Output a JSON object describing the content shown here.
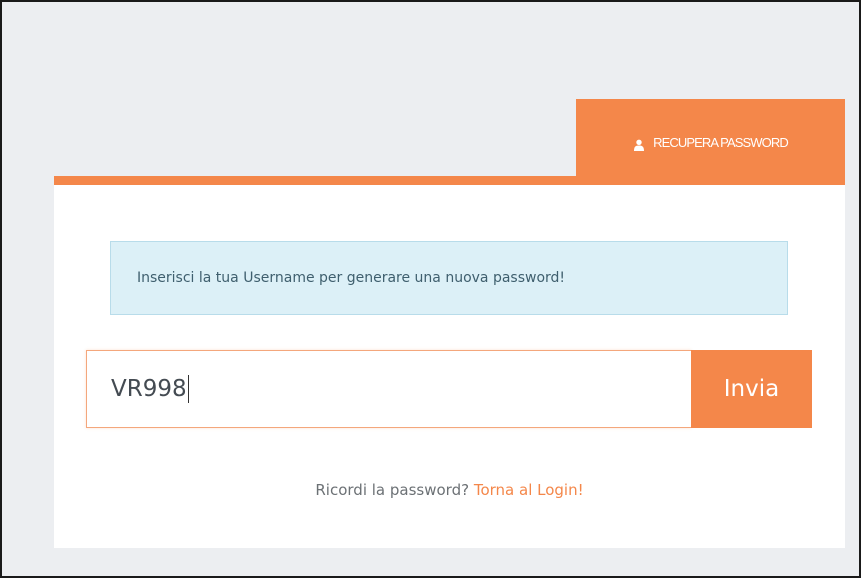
{
  "tab": {
    "icon": "user-icon",
    "label": "RECUPERA PASSWORD"
  },
  "alert": {
    "text": "Inserisci la tua Username per generare una nuova password!"
  },
  "form": {
    "username_value": "VR998",
    "send_label": "Invia"
  },
  "footer": {
    "question": "Ricordi la password?",
    "link_label": "Torna al Login!"
  },
  "colors": {
    "accent": "#f4874a",
    "alert_bg": "#dcf0f7",
    "page_bg": "#eceef1"
  }
}
